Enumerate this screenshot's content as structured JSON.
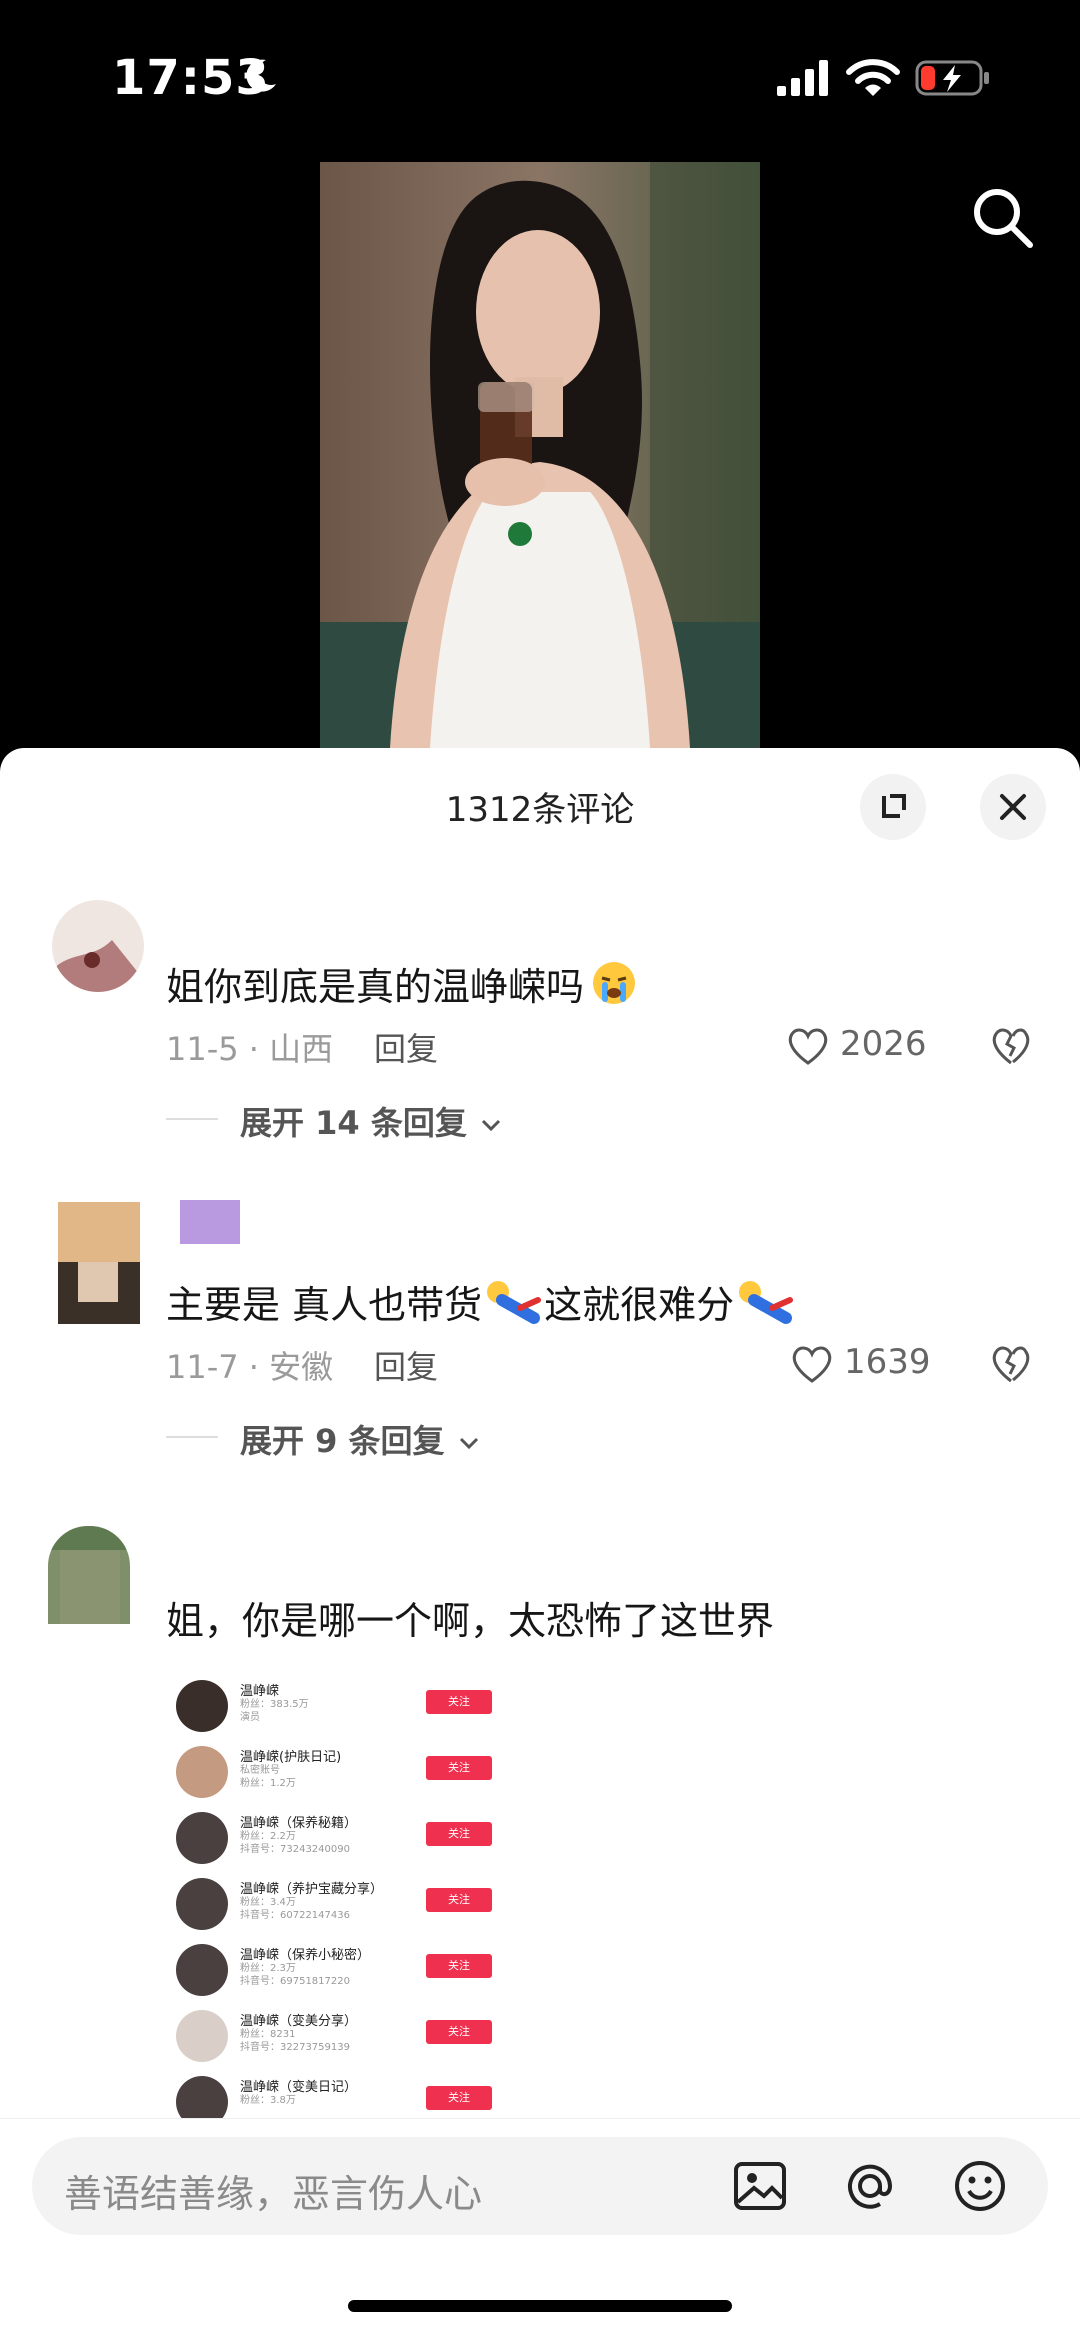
{
  "status_bar": {
    "time": "17:53"
  },
  "sheet": {
    "title": "1312条评论",
    "comments": [
      {
        "text": "姐你到底是真的温峥嵘吗",
        "date_location": "11-5 · 山西",
        "reply_label": "回复",
        "likes": "2026",
        "expand_label": "展开 14 条回复"
      },
      {
        "text": "主要是 真人也带货",
        "text_suffix": "这就很难分",
        "date_location": "11-7 · 安徽",
        "reply_label": "回复",
        "likes": "1639",
        "expand_label": "展开 9 条回复"
      },
      {
        "text": "姐，你是哪一个啊，太恐怖了这世界"
      }
    ],
    "attachment": {
      "follow_label": "关注",
      "accounts": [
        {
          "name": "温峥嵘",
          "line1": "粉丝：383.5万",
          "line2": "演员"
        },
        {
          "name": "温峥嵘(护肤日记)",
          "line1": "私密账号",
          "line2": "粉丝：1.2万"
        },
        {
          "name": "温峥嵘（保养秘籍）",
          "line1": "粉丝：2.2万",
          "line2": "抖音号：73243240090"
        },
        {
          "name": "温峥嵘（养护宝藏分享）",
          "line1": "粉丝：3.4万",
          "line2": "抖音号：60722147436"
        },
        {
          "name": "温峥嵘（保养小秘密）",
          "line1": "粉丝：2.3万",
          "line2": "抖音号：69751817220"
        },
        {
          "name": "温峥嵘（变美分享）",
          "line1": "粉丝：8231",
          "line2": "抖音号：32273759139"
        },
        {
          "name": "温峥嵘（变美日记）",
          "line1": "粉丝：3.8万",
          "line2": ""
        }
      ]
    }
  },
  "input": {
    "placeholder": "善语结善缘，恶言伤人心"
  },
  "icons": [
    "moon-icon",
    "signal-icon",
    "wifi-icon",
    "battery-icon",
    "search-icon",
    "fullscreen-icon",
    "close-icon",
    "heart-icon",
    "broken-heart-icon",
    "chevron-down-icon",
    "image-icon",
    "at-icon",
    "emoji-icon"
  ]
}
